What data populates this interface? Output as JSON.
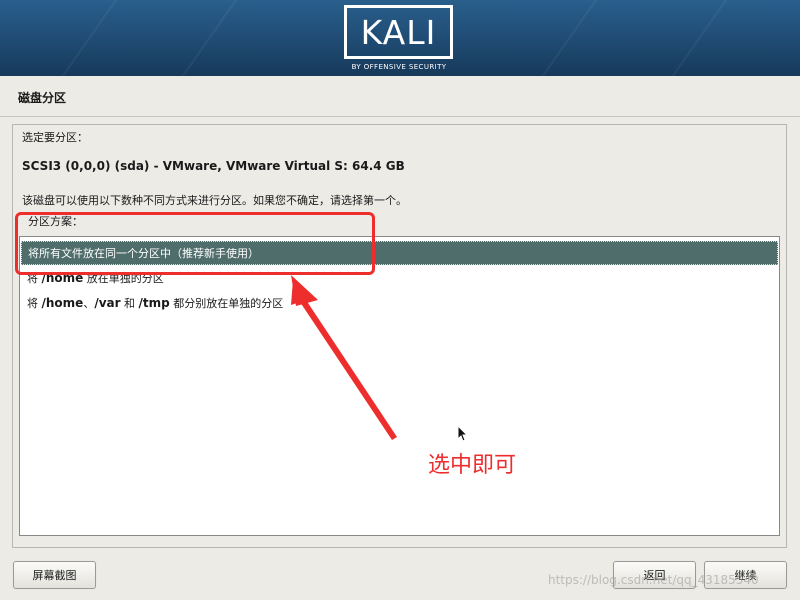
{
  "banner": {
    "logo_text": "KALI",
    "logo_subtitle": "BY OFFENSIVE SECURITY",
    "background": "#1f4b73"
  },
  "page": {
    "title": "磁盘分区",
    "prompt": "选定要分区：",
    "disk": "SCSI3 (0,0,0) (sda) - VMware, VMware Virtual S: 64.4 GB",
    "description": "该磁盘可以使用以下数种不同方式来进行分区。如果您不确定，请选择第一个。",
    "scheme_label": "分区方案："
  },
  "options": [
    {
      "text": "将所有文件放在同一个分区中（推荐新手使用）",
      "selected": true
    },
    {
      "pre": "将 ",
      "bold1": "/home",
      "post": " 放在单独的分区",
      "selected": false
    },
    {
      "pre": "将 ",
      "bold1": "/home",
      "mid1": "、",
      "bold2": "/var",
      "mid2": " 和 ",
      "bold3": "/tmp",
      "post": " 都分别放在单独的分区",
      "selected": false
    }
  ],
  "annotation": {
    "text": "选中即可",
    "color": "#ee2d2d"
  },
  "buttons": {
    "screenshot": "屏幕截图",
    "back": "返回",
    "continue": "继续"
  },
  "watermark": "https://blog.csdn.net/qq_43185540",
  "colors": {
    "selected_row": "#4f6d6a",
    "page_bg": "#ecebe6"
  }
}
